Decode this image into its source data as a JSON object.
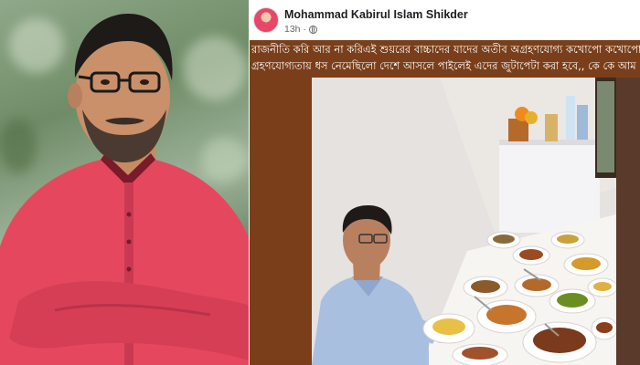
{
  "post": {
    "author": "Mohammad Kabirul Islam Shikder",
    "time": "13h",
    "dot": "·",
    "text_line_1": "রাজনীতি করি আর না করিএই শুয়রের বাচ্চাদের যাদের অতীব অগ্রহণযোগ্য  কখোপো কখোপো",
    "text_line_2": "গ্রহণযোগ্যতায় ধস নেমেছিলো দেশে আসলে পাইলেই এদের  জুটাপেটা করা হবে,, কে কে আম"
  },
  "colors": {
    "text_bg": "#7a3f1a",
    "shirt_left": "#e5485e",
    "shirt_right": "#a9bfe0"
  }
}
